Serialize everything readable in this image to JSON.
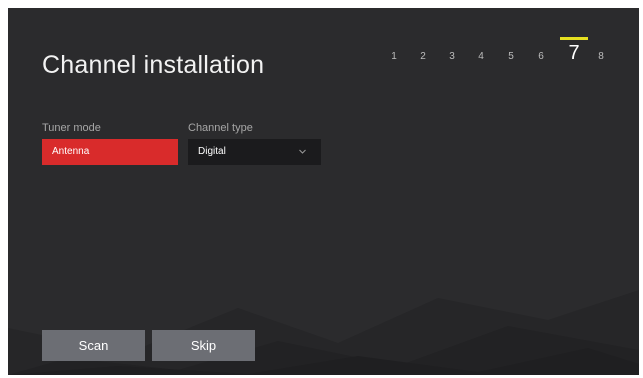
{
  "header": {
    "title": "Channel installation"
  },
  "wizard": {
    "steps": [
      "1",
      "2",
      "3",
      "4",
      "5",
      "6",
      "7",
      "8"
    ],
    "current_step": "7",
    "indicator_color": "#e6e020"
  },
  "form": {
    "tuner_mode": {
      "label": "Tuner mode",
      "value": "Antenna",
      "color": "#d92b2b"
    },
    "channel_type": {
      "label": "Channel type",
      "value": "Digital",
      "chevron_icon": "chevron-down-icon"
    }
  },
  "actions": {
    "scan_label": "Scan",
    "skip_label": "Skip"
  }
}
